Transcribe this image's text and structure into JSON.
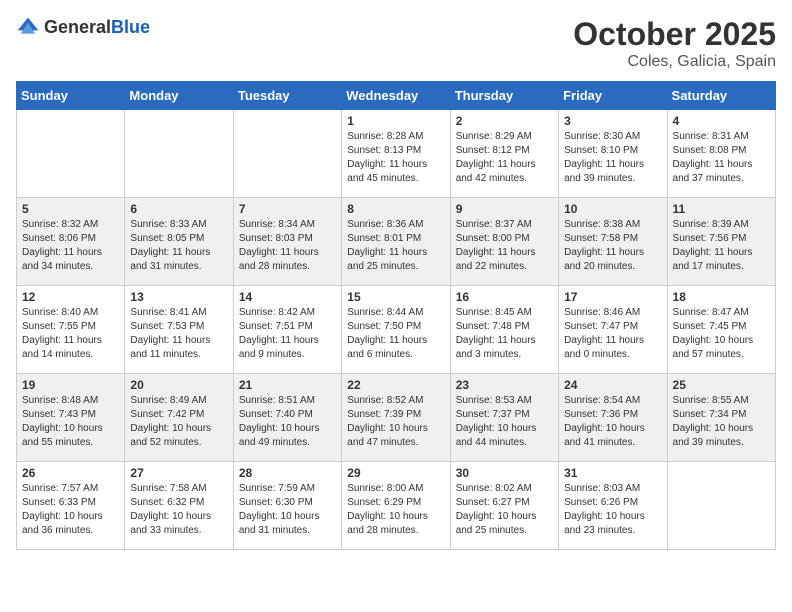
{
  "header": {
    "logo_general": "General",
    "logo_blue": "Blue",
    "title": "October 2025",
    "location": "Coles, Galicia, Spain"
  },
  "days_of_week": [
    "Sunday",
    "Monday",
    "Tuesday",
    "Wednesday",
    "Thursday",
    "Friday",
    "Saturday"
  ],
  "weeks": [
    [
      {
        "day": "",
        "content": ""
      },
      {
        "day": "",
        "content": ""
      },
      {
        "day": "",
        "content": ""
      },
      {
        "day": "1",
        "content": "Sunrise: 8:28 AM\nSunset: 8:13 PM\nDaylight: 11 hours\nand 45 minutes."
      },
      {
        "day": "2",
        "content": "Sunrise: 8:29 AM\nSunset: 8:12 PM\nDaylight: 11 hours\nand 42 minutes."
      },
      {
        "day": "3",
        "content": "Sunrise: 8:30 AM\nSunset: 8:10 PM\nDaylight: 11 hours\nand 39 minutes."
      },
      {
        "day": "4",
        "content": "Sunrise: 8:31 AM\nSunset: 8:08 PM\nDaylight: 11 hours\nand 37 minutes."
      }
    ],
    [
      {
        "day": "5",
        "content": "Sunrise: 8:32 AM\nSunset: 8:06 PM\nDaylight: 11 hours\nand 34 minutes."
      },
      {
        "day": "6",
        "content": "Sunrise: 8:33 AM\nSunset: 8:05 PM\nDaylight: 11 hours\nand 31 minutes."
      },
      {
        "day": "7",
        "content": "Sunrise: 8:34 AM\nSunset: 8:03 PM\nDaylight: 11 hours\nand 28 minutes."
      },
      {
        "day": "8",
        "content": "Sunrise: 8:36 AM\nSunset: 8:01 PM\nDaylight: 11 hours\nand 25 minutes."
      },
      {
        "day": "9",
        "content": "Sunrise: 8:37 AM\nSunset: 8:00 PM\nDaylight: 11 hours\nand 22 minutes."
      },
      {
        "day": "10",
        "content": "Sunrise: 8:38 AM\nSunset: 7:58 PM\nDaylight: 11 hours\nand 20 minutes."
      },
      {
        "day": "11",
        "content": "Sunrise: 8:39 AM\nSunset: 7:56 PM\nDaylight: 11 hours\nand 17 minutes."
      }
    ],
    [
      {
        "day": "12",
        "content": "Sunrise: 8:40 AM\nSunset: 7:55 PM\nDaylight: 11 hours\nand 14 minutes."
      },
      {
        "day": "13",
        "content": "Sunrise: 8:41 AM\nSunset: 7:53 PM\nDaylight: 11 hours\nand 11 minutes."
      },
      {
        "day": "14",
        "content": "Sunrise: 8:42 AM\nSunset: 7:51 PM\nDaylight: 11 hours\nand 9 minutes."
      },
      {
        "day": "15",
        "content": "Sunrise: 8:44 AM\nSunset: 7:50 PM\nDaylight: 11 hours\nand 6 minutes."
      },
      {
        "day": "16",
        "content": "Sunrise: 8:45 AM\nSunset: 7:48 PM\nDaylight: 11 hours\nand 3 minutes."
      },
      {
        "day": "17",
        "content": "Sunrise: 8:46 AM\nSunset: 7:47 PM\nDaylight: 11 hours\nand 0 minutes."
      },
      {
        "day": "18",
        "content": "Sunrise: 8:47 AM\nSunset: 7:45 PM\nDaylight: 10 hours\nand 57 minutes."
      }
    ],
    [
      {
        "day": "19",
        "content": "Sunrise: 8:48 AM\nSunset: 7:43 PM\nDaylight: 10 hours\nand 55 minutes."
      },
      {
        "day": "20",
        "content": "Sunrise: 8:49 AM\nSunset: 7:42 PM\nDaylight: 10 hours\nand 52 minutes."
      },
      {
        "day": "21",
        "content": "Sunrise: 8:51 AM\nSunset: 7:40 PM\nDaylight: 10 hours\nand 49 minutes."
      },
      {
        "day": "22",
        "content": "Sunrise: 8:52 AM\nSunset: 7:39 PM\nDaylight: 10 hours\nand 47 minutes."
      },
      {
        "day": "23",
        "content": "Sunrise: 8:53 AM\nSunset: 7:37 PM\nDaylight: 10 hours\nand 44 minutes."
      },
      {
        "day": "24",
        "content": "Sunrise: 8:54 AM\nSunset: 7:36 PM\nDaylight: 10 hours\nand 41 minutes."
      },
      {
        "day": "25",
        "content": "Sunrise: 8:55 AM\nSunset: 7:34 PM\nDaylight: 10 hours\nand 39 minutes."
      }
    ],
    [
      {
        "day": "26",
        "content": "Sunrise: 7:57 AM\nSunset: 6:33 PM\nDaylight: 10 hours\nand 36 minutes."
      },
      {
        "day": "27",
        "content": "Sunrise: 7:58 AM\nSunset: 6:32 PM\nDaylight: 10 hours\nand 33 minutes."
      },
      {
        "day": "28",
        "content": "Sunrise: 7:59 AM\nSunset: 6:30 PM\nDaylight: 10 hours\nand 31 minutes."
      },
      {
        "day": "29",
        "content": "Sunrise: 8:00 AM\nSunset: 6:29 PM\nDaylight: 10 hours\nand 28 minutes."
      },
      {
        "day": "30",
        "content": "Sunrise: 8:02 AM\nSunset: 6:27 PM\nDaylight: 10 hours\nand 25 minutes."
      },
      {
        "day": "31",
        "content": "Sunrise: 8:03 AM\nSunset: 6:26 PM\nDaylight: 10 hours\nand 23 minutes."
      },
      {
        "day": "",
        "content": ""
      }
    ]
  ]
}
